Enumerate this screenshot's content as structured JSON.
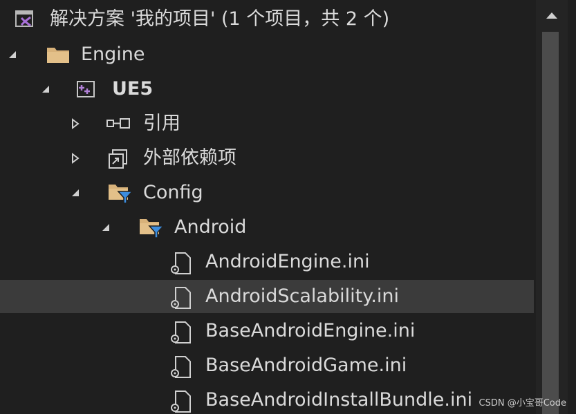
{
  "solution": {
    "label": "解决方案 '我的项目' (1 个项目，共 2 个)",
    "icon": "visual-studio-solution-icon"
  },
  "tree": {
    "engine": {
      "label": "Engine",
      "icon": "folder-icon"
    },
    "ue5": {
      "label": "UE5",
      "icon": "cpp-project-icon"
    },
    "references": {
      "label": "引用",
      "icon": "references-icon"
    },
    "external_deps": {
      "label": "外部依赖项",
      "icon": "external-dependencies-icon"
    },
    "config": {
      "label": "Config",
      "icon": "filter-folder-icon"
    },
    "android": {
      "label": "Android",
      "icon": "filter-folder-icon"
    },
    "files": [
      {
        "label": "AndroidEngine.ini",
        "icon": "settings-file-icon"
      },
      {
        "label": "AndroidScalability.ini",
        "icon": "settings-file-icon",
        "selected": true
      },
      {
        "label": "BaseAndroidEngine.ini",
        "icon": "settings-file-icon"
      },
      {
        "label": "BaseAndroidGame.ini",
        "icon": "settings-file-icon"
      },
      {
        "label": "BaseAndroidInstallBundle.ini",
        "icon": "settings-file-icon"
      }
    ]
  },
  "watermark": "CSDN @小宝哥Code",
  "colors": {
    "background": "#1f1f1f",
    "selected_row": "#3b3b3b",
    "text": "#dadada",
    "folder": "#dcb67a",
    "filter_blue": "#3c8dde",
    "project_purple": "#b180d7"
  }
}
